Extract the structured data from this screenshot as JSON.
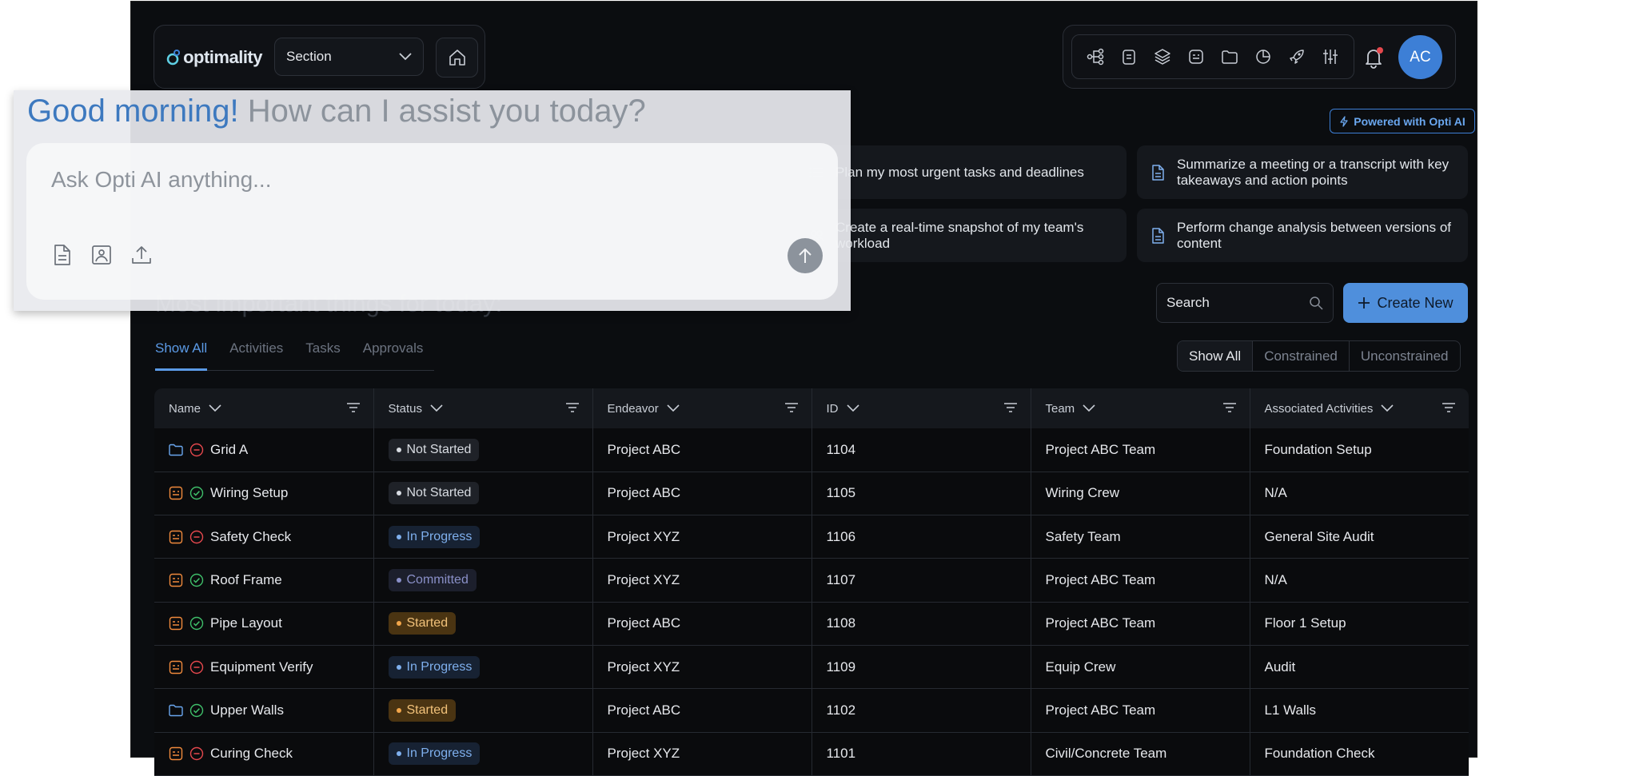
{
  "header": {
    "logo_text": "optimality",
    "section_select": "Section",
    "toolbar_icons": [
      "flow-icon",
      "clipboard-icon",
      "layers-icon",
      "badge-icon",
      "folder-icon",
      "pie-chart-icon",
      "rocket-icon",
      "sliders-icon"
    ],
    "avatar_initials": "AC",
    "notification_dot_color": "#e5484d"
  },
  "ai": {
    "greeting": "Good morning!",
    "question": "How can I assist you today?",
    "placeholder": "Ask Opti AI anything...",
    "powered": "Powered with Opti AI"
  },
  "suggestions": [
    {
      "text": "Plan my most urgent tasks and deadlines"
    },
    {
      "text": "Summarize a meeting or a transcript with key takeaways and action points"
    },
    {
      "text": "Create a real-time snapshot of my team's workload"
    },
    {
      "text": "Perform change analysis between versions of content"
    }
  ],
  "main": {
    "title": "Most important things for today:",
    "search_label": "Search",
    "create_label": "Create New",
    "tabs": [
      "Show All",
      "Activities",
      "Tasks",
      "Approvals"
    ],
    "filters": [
      "Show All",
      "Constrained",
      "Unconstrained"
    ]
  },
  "table": {
    "columns": [
      "Name",
      "Status",
      "Endeavor",
      "ID",
      "Team",
      "Associated Activities"
    ],
    "rows": [
      {
        "name": "Grid A",
        "status": "Not Started",
        "endeavor": "Project ABC",
        "id": "1104",
        "team": "Project ABC Team",
        "activities": "Foundation Setup"
      },
      {
        "name": "Wiring Setup",
        "status": "Not Started",
        "endeavor": "Project ABC",
        "id": "1105",
        "team": "Wiring Crew",
        "activities": "N/A"
      },
      {
        "name": "Safety Check",
        "status": "In Progress",
        "endeavor": "Project XYZ",
        "id": "1106",
        "team": "Safety Team",
        "activities": "General Site Audit"
      },
      {
        "name": "Roof Frame",
        "status": "Committed",
        "endeavor": "Project XYZ",
        "id": "1107",
        "team": "Project ABC Team",
        "activities": "N/A"
      },
      {
        "name": "Pipe Layout",
        "status": "Started",
        "endeavor": "Project ABC",
        "id": "1108",
        "team": "Project ABC Team",
        "activities": "Floor 1 Setup"
      },
      {
        "name": "Equipment Verify",
        "status": "In Progress",
        "endeavor": "Project XYZ",
        "id": "1109",
        "team": "Equip Crew",
        "activities": "Audit"
      },
      {
        "name": "Upper Walls",
        "status": "Started",
        "endeavor": "Project ABC",
        "id": "1102",
        "team": "Project ABC Team",
        "activities": "L1 Walls"
      },
      {
        "name": "Curing Check",
        "status": "In Progress",
        "endeavor": "Project XYZ",
        "id": "1101",
        "team": "Civil/Concrete Team",
        "activities": "Foundation Check"
      }
    ]
  }
}
